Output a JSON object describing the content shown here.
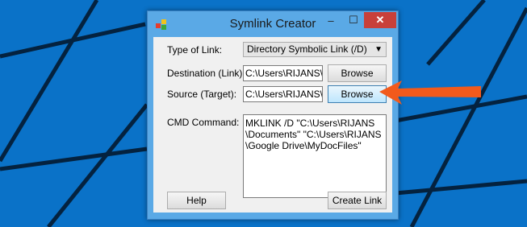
{
  "window": {
    "title": "Symlink Creator",
    "controls": {
      "minimize": "–",
      "maximize": "☐",
      "close": "✕"
    }
  },
  "form": {
    "type_label": "Type of Link:",
    "type_value": "Directory Symbolic Link (/D)",
    "destination_label": "Destination (Link):",
    "destination_value": "C:\\Users\\RIJANS\\D",
    "source_label": "Source (Target):",
    "source_value": "C:\\Users\\RIJANS\\C",
    "browse_label": "Browse",
    "cmd_label": "CMD Command:",
    "cmd_value": "MKLINK /D \"C:\\Users\\RIJANS\\Documents\" \"C:\\Users\\RIJANS\\Google Drive\\MyDocFiles\""
  },
  "buttons": {
    "help": "Help",
    "create": "Create Link"
  },
  "icons": {
    "app": "app-icon",
    "dropdown": "chevron-down-icon",
    "annotation": "arrow-left-icon"
  },
  "colors": {
    "desktop": "#0a72c8",
    "window_frame": "#5aa9e6",
    "close_button": "#c8403a",
    "annotation_arrow": "#f25a1c"
  }
}
